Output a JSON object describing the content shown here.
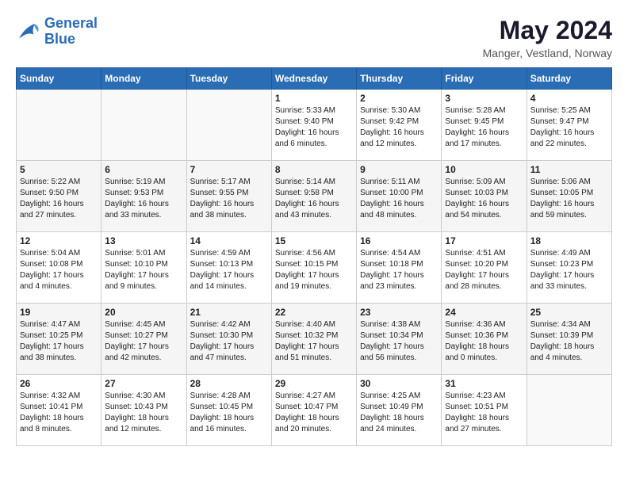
{
  "header": {
    "logo_line1": "General",
    "logo_line2": "Blue",
    "month_title": "May 2024",
    "location": "Manger, Vestland, Norway"
  },
  "days_of_week": [
    "Sunday",
    "Monday",
    "Tuesday",
    "Wednesday",
    "Thursday",
    "Friday",
    "Saturday"
  ],
  "weeks": [
    [
      {
        "day": "",
        "content": ""
      },
      {
        "day": "",
        "content": ""
      },
      {
        "day": "",
        "content": ""
      },
      {
        "day": "1",
        "content": "Sunrise: 5:33 AM\nSunset: 9:40 PM\nDaylight: 16 hours\nand 6 minutes."
      },
      {
        "day": "2",
        "content": "Sunrise: 5:30 AM\nSunset: 9:42 PM\nDaylight: 16 hours\nand 12 minutes."
      },
      {
        "day": "3",
        "content": "Sunrise: 5:28 AM\nSunset: 9:45 PM\nDaylight: 16 hours\nand 17 minutes."
      },
      {
        "day": "4",
        "content": "Sunrise: 5:25 AM\nSunset: 9:47 PM\nDaylight: 16 hours\nand 22 minutes."
      }
    ],
    [
      {
        "day": "5",
        "content": "Sunrise: 5:22 AM\nSunset: 9:50 PM\nDaylight: 16 hours\nand 27 minutes."
      },
      {
        "day": "6",
        "content": "Sunrise: 5:19 AM\nSunset: 9:53 PM\nDaylight: 16 hours\nand 33 minutes."
      },
      {
        "day": "7",
        "content": "Sunrise: 5:17 AM\nSunset: 9:55 PM\nDaylight: 16 hours\nand 38 minutes."
      },
      {
        "day": "8",
        "content": "Sunrise: 5:14 AM\nSunset: 9:58 PM\nDaylight: 16 hours\nand 43 minutes."
      },
      {
        "day": "9",
        "content": "Sunrise: 5:11 AM\nSunset: 10:00 PM\nDaylight: 16 hours\nand 48 minutes."
      },
      {
        "day": "10",
        "content": "Sunrise: 5:09 AM\nSunset: 10:03 PM\nDaylight: 16 hours\nand 54 minutes."
      },
      {
        "day": "11",
        "content": "Sunrise: 5:06 AM\nSunset: 10:05 PM\nDaylight: 16 hours\nand 59 minutes."
      }
    ],
    [
      {
        "day": "12",
        "content": "Sunrise: 5:04 AM\nSunset: 10:08 PM\nDaylight: 17 hours\nand 4 minutes."
      },
      {
        "day": "13",
        "content": "Sunrise: 5:01 AM\nSunset: 10:10 PM\nDaylight: 17 hours\nand 9 minutes."
      },
      {
        "day": "14",
        "content": "Sunrise: 4:59 AM\nSunset: 10:13 PM\nDaylight: 17 hours\nand 14 minutes."
      },
      {
        "day": "15",
        "content": "Sunrise: 4:56 AM\nSunset: 10:15 PM\nDaylight: 17 hours\nand 19 minutes."
      },
      {
        "day": "16",
        "content": "Sunrise: 4:54 AM\nSunset: 10:18 PM\nDaylight: 17 hours\nand 23 minutes."
      },
      {
        "day": "17",
        "content": "Sunrise: 4:51 AM\nSunset: 10:20 PM\nDaylight: 17 hours\nand 28 minutes."
      },
      {
        "day": "18",
        "content": "Sunrise: 4:49 AM\nSunset: 10:23 PM\nDaylight: 17 hours\nand 33 minutes."
      }
    ],
    [
      {
        "day": "19",
        "content": "Sunrise: 4:47 AM\nSunset: 10:25 PM\nDaylight: 17 hours\nand 38 minutes."
      },
      {
        "day": "20",
        "content": "Sunrise: 4:45 AM\nSunset: 10:27 PM\nDaylight: 17 hours\nand 42 minutes."
      },
      {
        "day": "21",
        "content": "Sunrise: 4:42 AM\nSunset: 10:30 PM\nDaylight: 17 hours\nand 47 minutes."
      },
      {
        "day": "22",
        "content": "Sunrise: 4:40 AM\nSunset: 10:32 PM\nDaylight: 17 hours\nand 51 minutes."
      },
      {
        "day": "23",
        "content": "Sunrise: 4:38 AM\nSunset: 10:34 PM\nDaylight: 17 hours\nand 56 minutes."
      },
      {
        "day": "24",
        "content": "Sunrise: 4:36 AM\nSunset: 10:36 PM\nDaylight: 18 hours\nand 0 minutes."
      },
      {
        "day": "25",
        "content": "Sunrise: 4:34 AM\nSunset: 10:39 PM\nDaylight: 18 hours\nand 4 minutes."
      }
    ],
    [
      {
        "day": "26",
        "content": "Sunrise: 4:32 AM\nSunset: 10:41 PM\nDaylight: 18 hours\nand 8 minutes."
      },
      {
        "day": "27",
        "content": "Sunrise: 4:30 AM\nSunset: 10:43 PM\nDaylight: 18 hours\nand 12 minutes."
      },
      {
        "day": "28",
        "content": "Sunrise: 4:28 AM\nSunset: 10:45 PM\nDaylight: 18 hours\nand 16 minutes."
      },
      {
        "day": "29",
        "content": "Sunrise: 4:27 AM\nSunset: 10:47 PM\nDaylight: 18 hours\nand 20 minutes."
      },
      {
        "day": "30",
        "content": "Sunrise: 4:25 AM\nSunset: 10:49 PM\nDaylight: 18 hours\nand 24 minutes."
      },
      {
        "day": "31",
        "content": "Sunrise: 4:23 AM\nSunset: 10:51 PM\nDaylight: 18 hours\nand 27 minutes."
      },
      {
        "day": "",
        "content": ""
      }
    ]
  ]
}
